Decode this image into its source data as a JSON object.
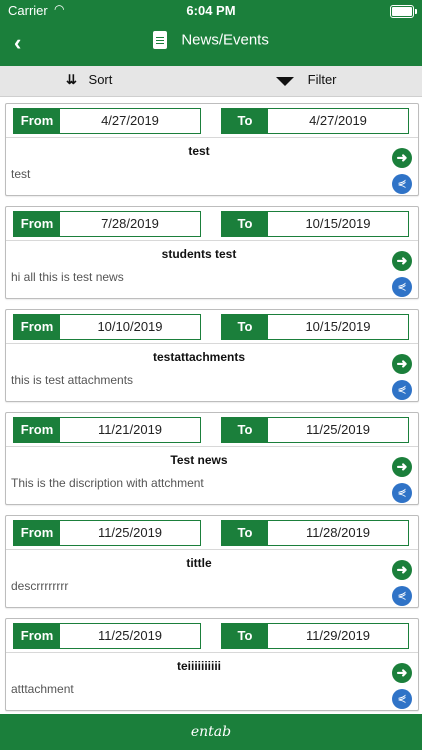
{
  "status": {
    "carrier": "Carrier",
    "wifi_icon": "wifi-icon",
    "time": "6:04 PM"
  },
  "header": {
    "back_icon": "chevron-left-icon",
    "title_icon": "document-icon",
    "title": "News/Events"
  },
  "toolbar": {
    "sort_label": "Sort",
    "filter_label": "Filter"
  },
  "labels": {
    "from": "From",
    "to": "To"
  },
  "items": [
    {
      "from": "4/27/2019",
      "to": "4/27/2019",
      "title": "test",
      "desc": "test"
    },
    {
      "from": "7/28/2019",
      "to": "10/15/2019",
      "title": "students test",
      "desc": "hi all this is test news"
    },
    {
      "from": "10/10/2019",
      "to": "10/15/2019",
      "title": "testattachments",
      "desc": "this is test attachments"
    },
    {
      "from": "11/21/2019",
      "to": "11/25/2019",
      "title": "Test news",
      "desc": "This is the discription with attchment"
    },
    {
      "from": "11/25/2019",
      "to": "11/28/2019",
      "title": "tittle",
      "desc": "descrrrrrrrr"
    },
    {
      "from": "11/25/2019",
      "to": "11/29/2019",
      "title": "teiiiiiiiiii",
      "desc": "atttachment"
    }
  ],
  "footer": {
    "brand": "entab"
  },
  "colors": {
    "primary": "#1b7f3b",
    "share": "#2f73c7",
    "toolbar": "#e6e6e6"
  }
}
